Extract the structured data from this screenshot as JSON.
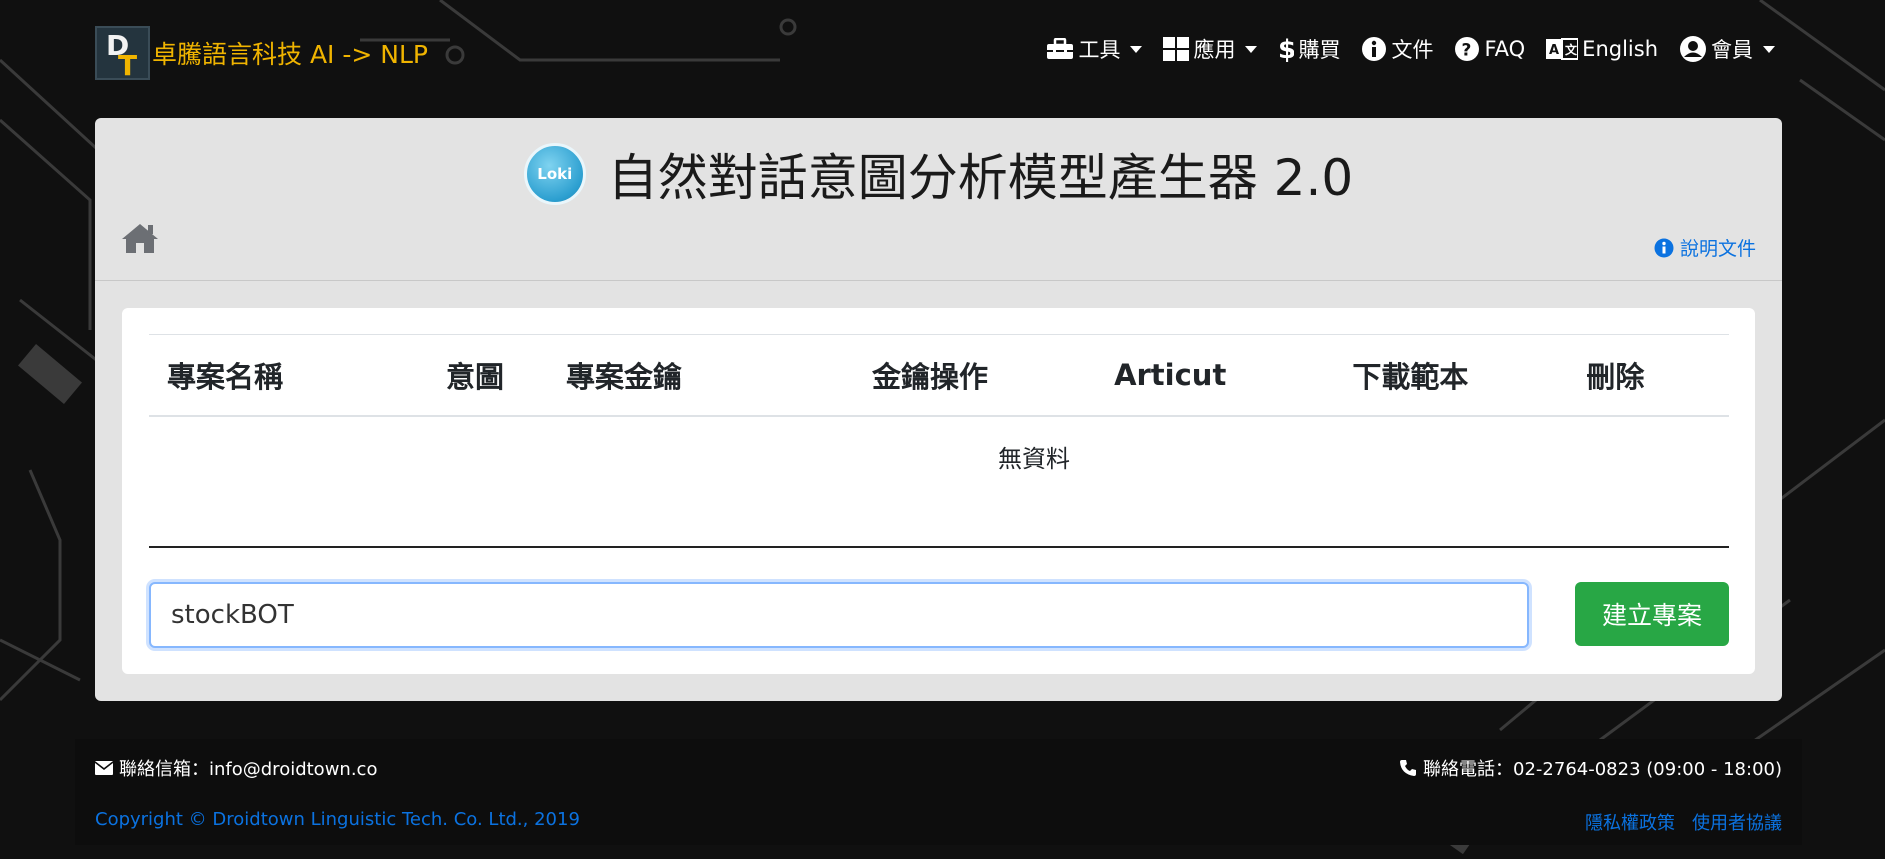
{
  "brand": {
    "logo_letters": [
      "D",
      "T"
    ],
    "name": "卓騰語言科技 AI -> NLP"
  },
  "nav": {
    "items": [
      {
        "label": "工具",
        "icon": "toolbox-icon",
        "dropdown": true
      },
      {
        "label": "應用",
        "icon": "grid-icon",
        "dropdown": true
      },
      {
        "label": "購買",
        "icon": "dollar-icon",
        "dropdown": false
      },
      {
        "label": "文件",
        "icon": "info-icon",
        "dropdown": false
      },
      {
        "label": "FAQ",
        "icon": "question-icon",
        "dropdown": false
      },
      {
        "label": "English",
        "icon": "language-icon",
        "dropdown": false
      },
      {
        "label": "會員",
        "icon": "user-icon",
        "dropdown": true
      }
    ]
  },
  "header": {
    "logo_text": "Loki",
    "title": "自然對話意圖分析模型產生器 2.0",
    "help_link": "說明文件"
  },
  "table": {
    "columns": [
      "專案名稱",
      "意圖",
      "專案金鑰",
      "金鑰操作",
      "Articut",
      "下載範本",
      "刪除"
    ],
    "empty_text": "無資料"
  },
  "create": {
    "input_value": "stockBOT",
    "button_label": "建立專案"
  },
  "footer": {
    "email": "聯絡信箱：info@droidtown.co",
    "phone": "聯絡電話：02-2764-0823 (09:00 - 18:00)",
    "copyright": "Copyright © Droidtown Linguistic Tech. Co. Ltd., 2019",
    "links": [
      "隱私權政策",
      "使用者協議"
    ]
  },
  "colors": {
    "brand": "#f0b400",
    "link": "#0b72e0",
    "primary_button": "#28a745",
    "background": "#101010"
  }
}
